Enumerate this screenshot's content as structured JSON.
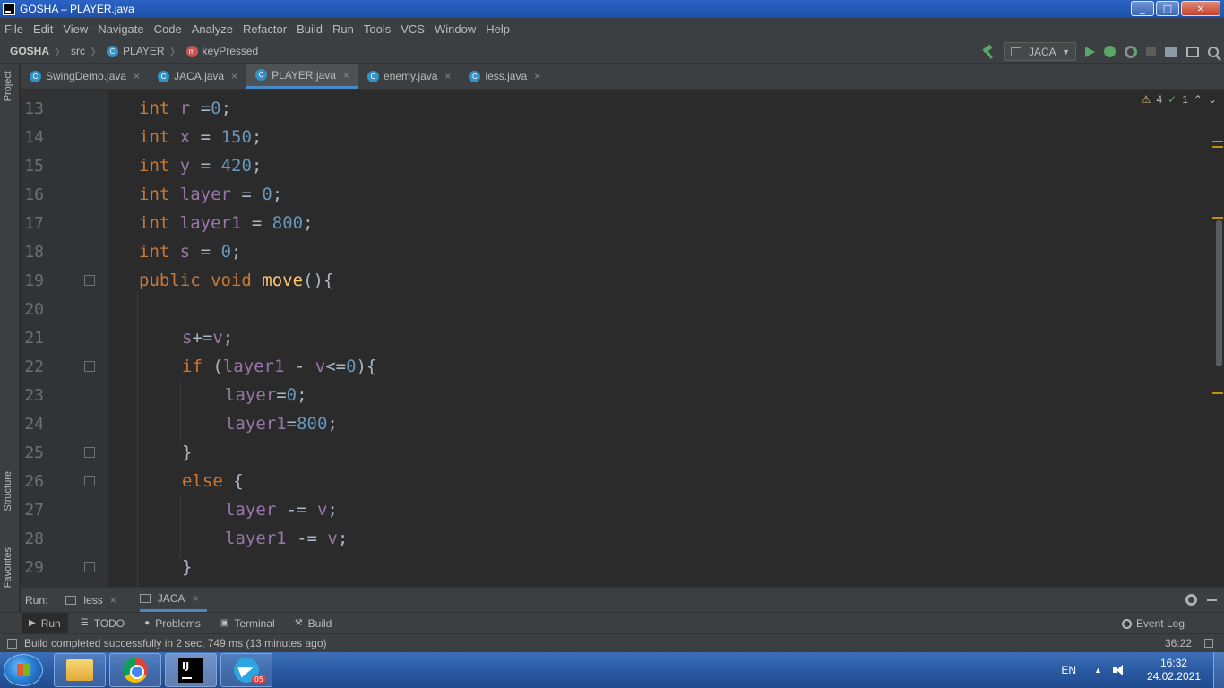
{
  "window": {
    "title": "GOSHA – PLAYER.java",
    "buttons": [
      "_",
      "□",
      "×"
    ]
  },
  "menu": [
    "File",
    "Edit",
    "View",
    "Navigate",
    "Code",
    "Analyze",
    "Refactor",
    "Build",
    "Run",
    "Tools",
    "VCS",
    "Window",
    "Help"
  ],
  "breadcrumb": {
    "project": "GOSHA",
    "folder": "src",
    "class": "PLAYER",
    "method": "keyPressed",
    "class_icon": "C",
    "method_icon": "m"
  },
  "toolbar": {
    "run_config": "JACA"
  },
  "side_tabs": {
    "project": "Project",
    "structure": "Structure",
    "favorites": "Favorites"
  },
  "tabs": [
    {
      "label": "SwingDemo.java",
      "icon": "C",
      "active": false
    },
    {
      "label": "JACA.java",
      "icon": "C",
      "active": false
    },
    {
      "label": "PLAYER.java",
      "icon": "C",
      "active": true
    },
    {
      "label": "enemy.java",
      "icon": "C",
      "active": false
    },
    {
      "label": "less.java",
      "icon": "C",
      "active": false
    }
  ],
  "tab_close": "×",
  "inspections": {
    "warnings": "4",
    "weak_warnings": "1"
  },
  "lines": [
    "13",
    "14",
    "15",
    "16",
    "17",
    "18",
    "19",
    "20",
    "21",
    "22",
    "23",
    "24",
    "25",
    "26",
    "27",
    "28",
    "29"
  ],
  "run_window": {
    "label": "Run:",
    "tabs": [
      "less",
      "JACA"
    ]
  },
  "bottom_tools": [
    "Run",
    "TODO",
    "Problems",
    "Terminal",
    "Build"
  ],
  "event_log": "Event Log",
  "status": {
    "message": "Build completed successfully in 2 sec, 749 ms (13 minutes ago)",
    "position": "36:22"
  },
  "taskbar": {
    "language": "EN",
    "time": "16:32",
    "date": "24.02.2021",
    "telegram_badge": "05",
    "intellij_label": "IJ"
  }
}
